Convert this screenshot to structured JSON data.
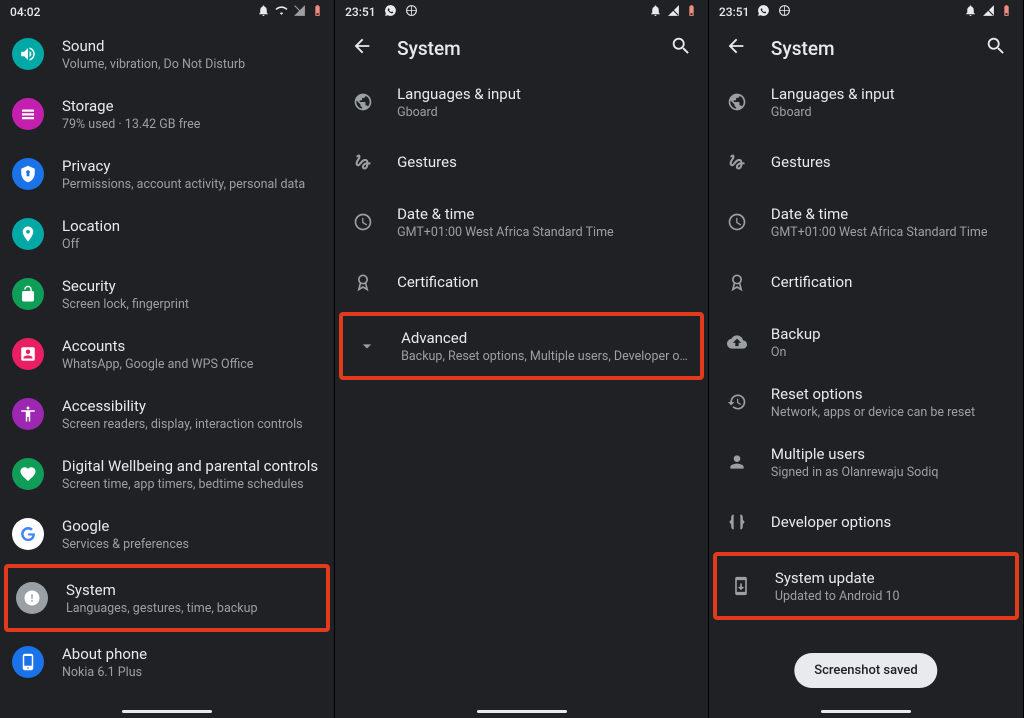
{
  "panel1": {
    "statusbar": {
      "time": "04:02"
    },
    "items": [
      {
        "icon": "sound",
        "bg": "#00a9a5",
        "title": "Sound",
        "sub": "Volume, vibration, Do Not Disturb"
      },
      {
        "icon": "storage",
        "bg": "#c51fb0",
        "title": "Storage",
        "sub": "79% used · 13.42 GB free"
      },
      {
        "icon": "privacy",
        "bg": "#1a73e8",
        "title": "Privacy",
        "sub": "Permissions, account activity, personal data"
      },
      {
        "icon": "location",
        "bg": "#00a9a5",
        "title": "Location",
        "sub": "Off"
      },
      {
        "icon": "security",
        "bg": "#0f9d58",
        "title": "Security",
        "sub": "Screen lock, fingerprint"
      },
      {
        "icon": "accounts",
        "bg": "#e91e63",
        "title": "Accounts",
        "sub": "WhatsApp, Google and WPS Office"
      },
      {
        "icon": "accessibility",
        "bg": "#9c27b0",
        "title": "Accessibility",
        "sub": "Screen readers, display, interaction controls"
      },
      {
        "icon": "wellbeing",
        "bg": "#0f9d58",
        "title": "Digital Wellbeing and parental controls",
        "sub": "Screen time, app timers, bedtime schedules"
      },
      {
        "icon": "google",
        "bg": "#fff",
        "title": "Google",
        "sub": "Services & preferences"
      },
      {
        "icon": "system",
        "bg": "#9aa0a6",
        "title": "System",
        "sub": "Languages, gestures, time, backup",
        "highlight": true
      },
      {
        "icon": "about",
        "bg": "#1a73e8",
        "title": "About phone",
        "sub": "Nokia 6.1 Plus"
      }
    ]
  },
  "panel2": {
    "statusbar": {
      "time": "23:51"
    },
    "appbar_title": "System",
    "items": [
      {
        "icon": "globe",
        "title": "Languages & input",
        "sub": "Gboard"
      },
      {
        "icon": "gesture",
        "title": "Gestures"
      },
      {
        "icon": "clock",
        "title": "Date & time",
        "sub": "GMT+01:00 West Africa Standard Time"
      },
      {
        "icon": "badge",
        "title": "Certification"
      },
      {
        "icon": "chevron",
        "title": "Advanced",
        "sub": "Backup, Reset options, Multiple users, Developer o…",
        "highlight": true
      }
    ]
  },
  "panel3": {
    "statusbar": {
      "time": "23:51"
    },
    "appbar_title": "System",
    "items": [
      {
        "icon": "globe",
        "title": "Languages & input",
        "sub": "Gboard"
      },
      {
        "icon": "gesture",
        "title": "Gestures"
      },
      {
        "icon": "clock",
        "title": "Date & time",
        "sub": "GMT+01:00 West Africa Standard Time"
      },
      {
        "icon": "badge",
        "title": "Certification"
      },
      {
        "icon": "cloud",
        "title": "Backup",
        "sub": "On"
      },
      {
        "icon": "reset",
        "title": "Reset options",
        "sub": "Network, apps or device can be reset"
      },
      {
        "icon": "user",
        "title": "Multiple users",
        "sub": "Signed in as Olanrewaju Sodiq"
      },
      {
        "icon": "braces",
        "title": "Developer options"
      },
      {
        "icon": "update",
        "title": "System update",
        "sub": "Updated to Android 10",
        "highlight": true
      }
    ],
    "snackbar": "Screenshot saved"
  }
}
